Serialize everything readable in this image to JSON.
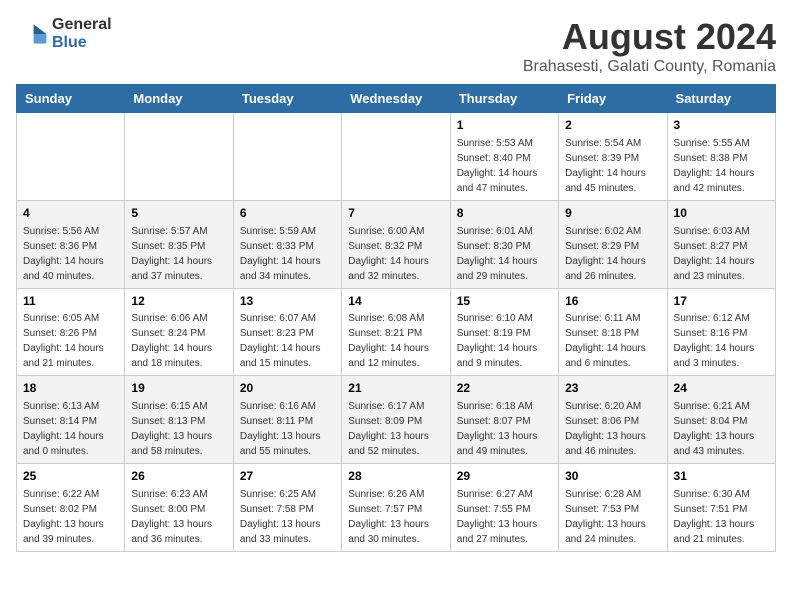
{
  "logo": {
    "general": "General",
    "blue": "Blue"
  },
  "title": "August 2024",
  "subtitle": "Brahasesti, Galati County, Romania",
  "days_of_week": [
    "Sunday",
    "Monday",
    "Tuesday",
    "Wednesday",
    "Thursday",
    "Friday",
    "Saturday"
  ],
  "weeks": [
    [
      {
        "day": "",
        "info": ""
      },
      {
        "day": "",
        "info": ""
      },
      {
        "day": "",
        "info": ""
      },
      {
        "day": "",
        "info": ""
      },
      {
        "day": "1",
        "info": "Sunrise: 5:53 AM\nSunset: 8:40 PM\nDaylight: 14 hours and 47 minutes."
      },
      {
        "day": "2",
        "info": "Sunrise: 5:54 AM\nSunset: 8:39 PM\nDaylight: 14 hours and 45 minutes."
      },
      {
        "day": "3",
        "info": "Sunrise: 5:55 AM\nSunset: 8:38 PM\nDaylight: 14 hours and 42 minutes."
      }
    ],
    [
      {
        "day": "4",
        "info": "Sunrise: 5:56 AM\nSunset: 8:36 PM\nDaylight: 14 hours and 40 minutes."
      },
      {
        "day": "5",
        "info": "Sunrise: 5:57 AM\nSunset: 8:35 PM\nDaylight: 14 hours and 37 minutes."
      },
      {
        "day": "6",
        "info": "Sunrise: 5:59 AM\nSunset: 8:33 PM\nDaylight: 14 hours and 34 minutes."
      },
      {
        "day": "7",
        "info": "Sunrise: 6:00 AM\nSunset: 8:32 PM\nDaylight: 14 hours and 32 minutes."
      },
      {
        "day": "8",
        "info": "Sunrise: 6:01 AM\nSunset: 8:30 PM\nDaylight: 14 hours and 29 minutes."
      },
      {
        "day": "9",
        "info": "Sunrise: 6:02 AM\nSunset: 8:29 PM\nDaylight: 14 hours and 26 minutes."
      },
      {
        "day": "10",
        "info": "Sunrise: 6:03 AM\nSunset: 8:27 PM\nDaylight: 14 hours and 23 minutes."
      }
    ],
    [
      {
        "day": "11",
        "info": "Sunrise: 6:05 AM\nSunset: 8:26 PM\nDaylight: 14 hours and 21 minutes."
      },
      {
        "day": "12",
        "info": "Sunrise: 6:06 AM\nSunset: 8:24 PM\nDaylight: 14 hours and 18 minutes."
      },
      {
        "day": "13",
        "info": "Sunrise: 6:07 AM\nSunset: 8:23 PM\nDaylight: 14 hours and 15 minutes."
      },
      {
        "day": "14",
        "info": "Sunrise: 6:08 AM\nSunset: 8:21 PM\nDaylight: 14 hours and 12 minutes."
      },
      {
        "day": "15",
        "info": "Sunrise: 6:10 AM\nSunset: 8:19 PM\nDaylight: 14 hours and 9 minutes."
      },
      {
        "day": "16",
        "info": "Sunrise: 6:11 AM\nSunset: 8:18 PM\nDaylight: 14 hours and 6 minutes."
      },
      {
        "day": "17",
        "info": "Sunrise: 6:12 AM\nSunset: 8:16 PM\nDaylight: 14 hours and 3 minutes."
      }
    ],
    [
      {
        "day": "18",
        "info": "Sunrise: 6:13 AM\nSunset: 8:14 PM\nDaylight: 14 hours and 0 minutes."
      },
      {
        "day": "19",
        "info": "Sunrise: 6:15 AM\nSunset: 8:13 PM\nDaylight: 13 hours and 58 minutes."
      },
      {
        "day": "20",
        "info": "Sunrise: 6:16 AM\nSunset: 8:11 PM\nDaylight: 13 hours and 55 minutes."
      },
      {
        "day": "21",
        "info": "Sunrise: 6:17 AM\nSunset: 8:09 PM\nDaylight: 13 hours and 52 minutes."
      },
      {
        "day": "22",
        "info": "Sunrise: 6:18 AM\nSunset: 8:07 PM\nDaylight: 13 hours and 49 minutes."
      },
      {
        "day": "23",
        "info": "Sunrise: 6:20 AM\nSunset: 8:06 PM\nDaylight: 13 hours and 46 minutes."
      },
      {
        "day": "24",
        "info": "Sunrise: 6:21 AM\nSunset: 8:04 PM\nDaylight: 13 hours and 43 minutes."
      }
    ],
    [
      {
        "day": "25",
        "info": "Sunrise: 6:22 AM\nSunset: 8:02 PM\nDaylight: 13 hours and 39 minutes."
      },
      {
        "day": "26",
        "info": "Sunrise: 6:23 AM\nSunset: 8:00 PM\nDaylight: 13 hours and 36 minutes."
      },
      {
        "day": "27",
        "info": "Sunrise: 6:25 AM\nSunset: 7:58 PM\nDaylight: 13 hours and 33 minutes."
      },
      {
        "day": "28",
        "info": "Sunrise: 6:26 AM\nSunset: 7:57 PM\nDaylight: 13 hours and 30 minutes."
      },
      {
        "day": "29",
        "info": "Sunrise: 6:27 AM\nSunset: 7:55 PM\nDaylight: 13 hours and 27 minutes."
      },
      {
        "day": "30",
        "info": "Sunrise: 6:28 AM\nSunset: 7:53 PM\nDaylight: 13 hours and 24 minutes."
      },
      {
        "day": "31",
        "info": "Sunrise: 6:30 AM\nSunset: 7:51 PM\nDaylight: 13 hours and 21 minutes."
      }
    ]
  ]
}
